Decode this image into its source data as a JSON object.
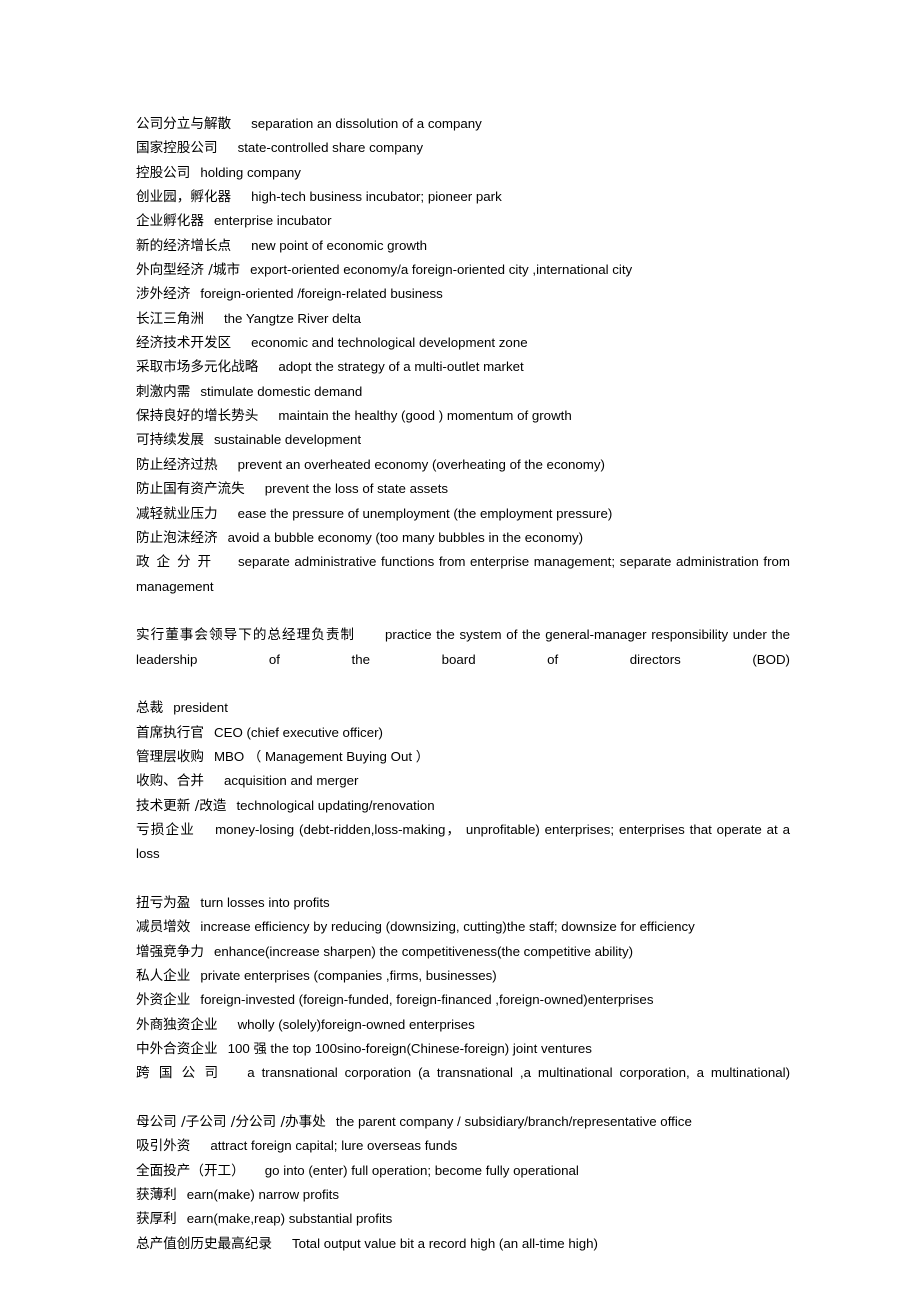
{
  "document": {
    "background_color": "#ffffff",
    "text_color": "#000000",
    "entries": [
      {
        "cn": "公司分立与解散",
        "gap": "md",
        "en": "separation an dissolution of a company",
        "wrapped": false,
        "spread": false
      },
      {
        "cn": "国家控股公司",
        "gap": "md",
        "en": "state-controlled share company",
        "wrapped": false,
        "spread": false
      },
      {
        "cn": "控股公司",
        "gap": "sm",
        "en": "holding company",
        "wrapped": false,
        "spread": false
      },
      {
        "cn": "创业园，孵化器",
        "gap": "md",
        "en": "high-tech business incubator; pioneer park",
        "wrapped": false,
        "spread": false
      },
      {
        "cn": "企业孵化器",
        "gap": "sm",
        "en": "enterprise incubator",
        "wrapped": false,
        "spread": false
      },
      {
        "cn": "新的经济增长点",
        "gap": "md",
        "en": "new point of economic growth",
        "wrapped": false,
        "spread": false
      },
      {
        "cn": "外向型经济 /城市",
        "gap": "sm",
        "en": "export-oriented economy/a foreign-oriented city ,international city",
        "wrapped": false,
        "spread": false
      },
      {
        "cn": "涉外经济",
        "gap": "sm",
        "en": "foreign-oriented /foreign-related business",
        "wrapped": false,
        "spread": false
      },
      {
        "cn": "长江三角洲",
        "gap": "md",
        "en": "the Yangtze River delta",
        "wrapped": false,
        "spread": false
      },
      {
        "cn": "经济技术开发区",
        "gap": "md",
        "en": "economic and technological development zone",
        "wrapped": false,
        "spread": false
      },
      {
        "cn": "采取市场多元化战略",
        "gap": "md",
        "en": "adopt the strategy of a multi-outlet market",
        "wrapped": false,
        "spread": false
      },
      {
        "cn": "刺激内需",
        "gap": "sm",
        "en": "stimulate domestic demand",
        "wrapped": false,
        "spread": false
      },
      {
        "cn": "保持良好的增长势头",
        "gap": "md",
        "en": "maintain the healthy (good ) momentum of growth",
        "wrapped": false,
        "spread": false
      },
      {
        "cn": "可持续发展",
        "gap": "sm",
        "en": "sustainable development",
        "wrapped": false,
        "spread": false
      },
      {
        "cn": "防止经济过热",
        "gap": "md",
        "en": "prevent an overheated economy (overheating of the economy)",
        "wrapped": false,
        "spread": false
      },
      {
        "cn": "防止国有资产流失",
        "gap": "md",
        "en": "prevent the loss of state assets",
        "wrapped": false,
        "spread": false
      },
      {
        "cn": "减轻就业压力",
        "gap": "md",
        "en": "ease the pressure of unemployment (the employment pressure)",
        "wrapped": false,
        "spread": false
      },
      {
        "cn": "防止泡沫经济",
        "gap": "sm",
        "en": "avoid a bubble economy (too many bubbles in the economy)",
        "wrapped": false,
        "spread": false
      },
      {
        "cn": "政企分开",
        "gap": "md",
        "en": "separate administrative functions from enterprise management; separate administration from management",
        "wrapped": true,
        "spread": true
      },
      {
        "cn": "实行董事会领导下的总经理负责制",
        "gap": "lg",
        "en": "practice the system of the general-manager responsibility under the leadership of the board of directors (BOD)",
        "wrapped": true,
        "spread": false
      },
      {
        "cn": "总裁",
        "gap": "sm",
        "en": "president",
        "wrapped": false,
        "spread": false
      },
      {
        "cn": "首席执行官",
        "gap": "sm",
        "en": "CEO    (chief executive officer)",
        "wrapped": false,
        "spread": false
      },
      {
        "cn": "管理层收购",
        "gap": "sm",
        "en": "MBO  （ Management Buying Out ）",
        "wrapped": false,
        "spread": false
      },
      {
        "cn": "收购、合并",
        "gap": "md",
        "en": "acquisition and merger",
        "wrapped": false,
        "spread": false
      },
      {
        "cn": "技术更新 /改造",
        "gap": "sm",
        "en": "technological updating/renovation",
        "wrapped": false,
        "spread": false
      },
      {
        "cn": "亏损企业",
        "gap": "md",
        "en": "money-losing (debt-ridden,loss-making， unprofitable) enterprises; enterprises that operate at a loss",
        "wrapped": true,
        "spread": false
      },
      {
        "cn": "扭亏为盈",
        "gap": "sm",
        "en": "turn losses into profits",
        "wrapped": false,
        "spread": false
      },
      {
        "cn": "减员增效",
        "gap": "sm",
        "en": "increase efficiency by reducing (downsizing, cutting)the staff; downsize for efficiency",
        "wrapped": false,
        "spread": false
      },
      {
        "cn": "增强竞争力",
        "gap": "sm",
        "en": "enhance(increase sharpen) the competitiveness(the competitive ability)",
        "wrapped": false,
        "spread": false
      },
      {
        "cn": "私人企业",
        "gap": "sm",
        "en": "private enterprises (companies ,firms, businesses)",
        "wrapped": false,
        "spread": false
      },
      {
        "cn": "外资企业",
        "gap": "sm",
        "en": "foreign-invested (foreign-funded, foreign-financed ,foreign-owned)enterprises",
        "wrapped": false,
        "spread": false
      },
      {
        "cn": "外商独资企业",
        "gap": "md",
        "en": "wholly (solely)foreign-owned enterprises",
        "wrapped": false,
        "spread": false
      },
      {
        "cn": "中外合资企业",
        "gap": "sm",
        "en": "100 强 the top 100sino-foreign(Chinese-foreign) joint ventures",
        "wrapped": false,
        "spread": false
      },
      {
        "cn": "跨国公司",
        "gap": "md",
        "en": "a transnational corporation (a transnational ,a multinational corporation, a multinational)",
        "wrapped": true,
        "spread": true
      },
      {
        "cn": "母公司 /子公司 /分公司 /办事处",
        "gap": "sm",
        "en": "the parent company / subsidiary/branch/representative office",
        "wrapped": false,
        "spread": false
      },
      {
        "cn": "吸引外资",
        "gap": "md",
        "en": "attract foreign capital; lure overseas funds",
        "wrapped": false,
        "spread": false
      },
      {
        "cn": "全面投产（开工）",
        "gap": "md",
        "en": "go into (enter) full operation; become fully operational",
        "wrapped": false,
        "spread": false
      },
      {
        "cn": "获薄利",
        "gap": "sm",
        "en": "earn(make) narrow profits",
        "wrapped": false,
        "spread": false
      },
      {
        "cn": "获厚利",
        "gap": "sm",
        "en": "earn(make,reap) substantial profits",
        "wrapped": false,
        "spread": false
      },
      {
        "cn": "总产值创历史最高纪录",
        "gap": "md",
        "en": "Total output value bit a record high (an all-time high)",
        "wrapped": false,
        "spread": false
      }
    ]
  }
}
